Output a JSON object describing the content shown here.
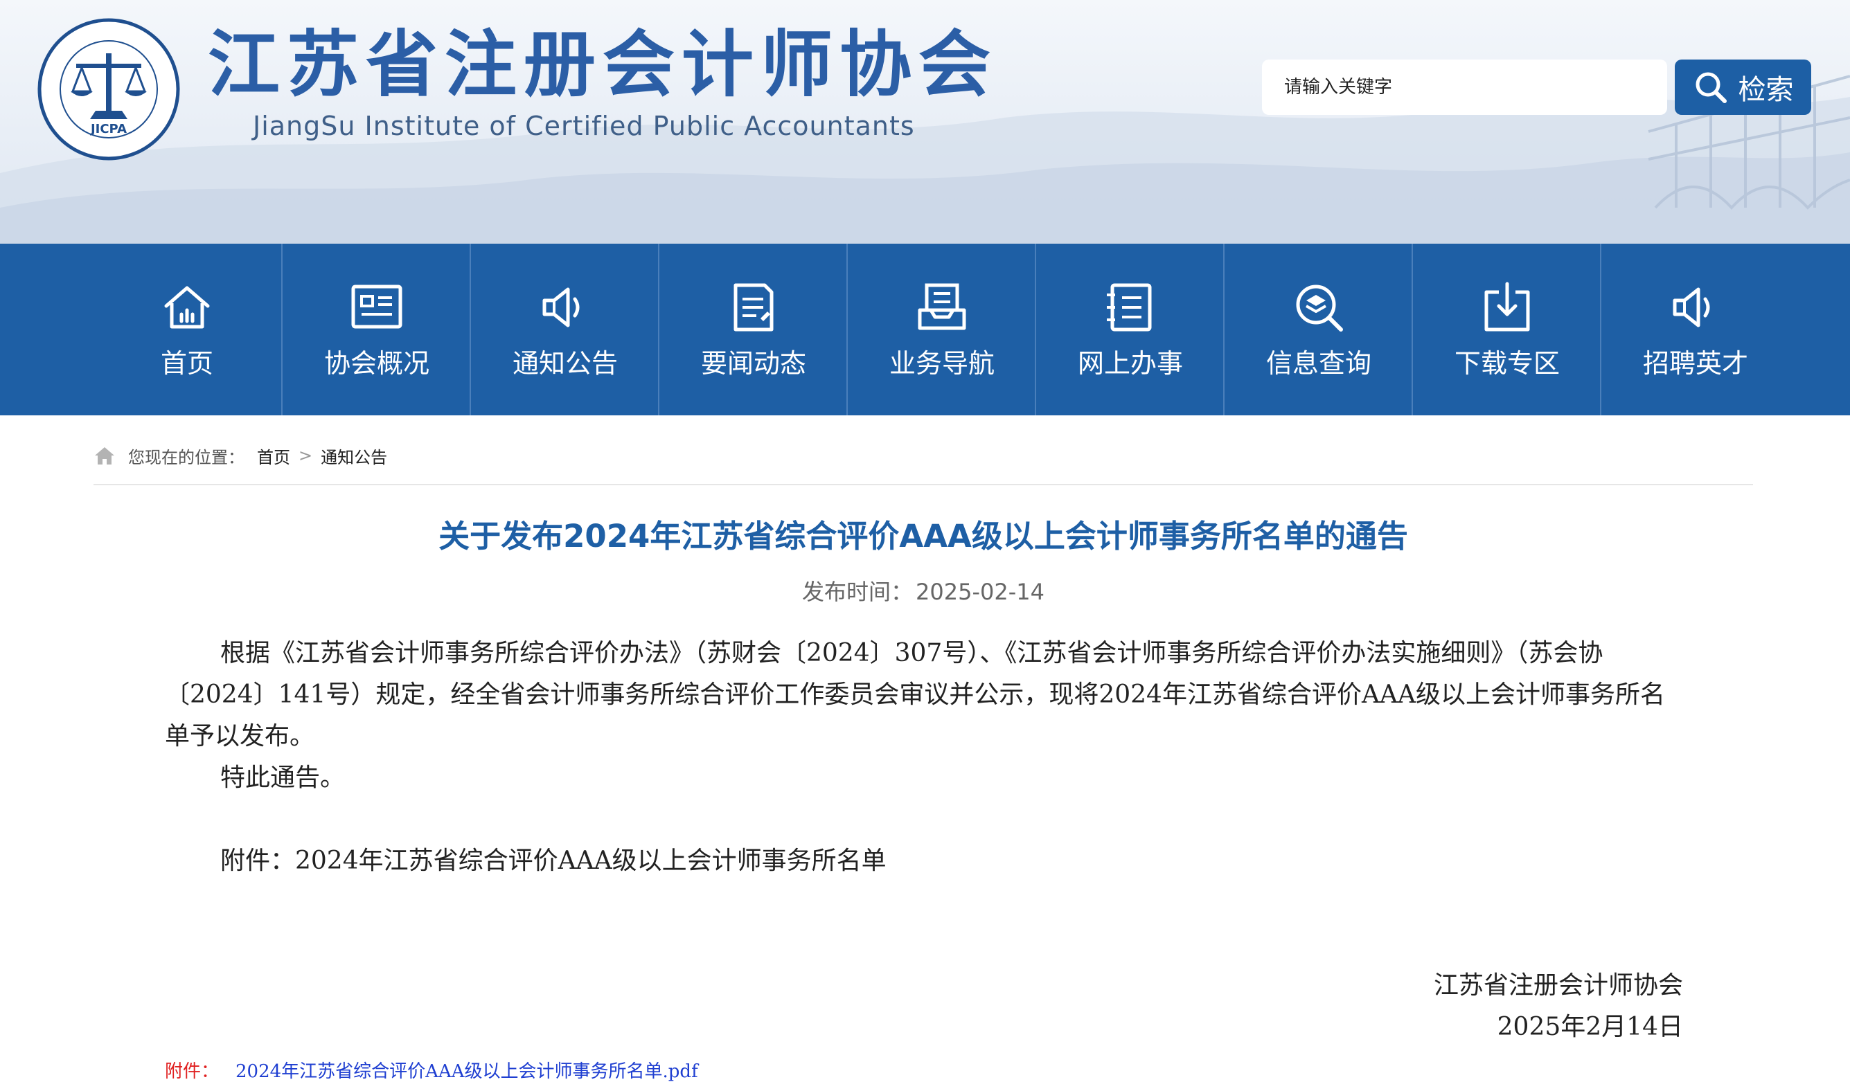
{
  "header": {
    "title": "江苏省注册会计师协会",
    "subtitle": "JiangSu Institute of Certified Public Accountants",
    "logo_text": "JIANGSU INSTITUTE OF CERTIFIED PUBLIC ACCOUNTANTS JICPA 江苏省注册会计师协会",
    "search_placeholder": "请输入关键字",
    "search_button": "检索"
  },
  "nav": {
    "items": [
      {
        "label": "首页",
        "icon": "home-icon"
      },
      {
        "label": "协会概况",
        "icon": "info-board-icon"
      },
      {
        "label": "通知公告",
        "icon": "speaker-icon"
      },
      {
        "label": "要闻动态",
        "icon": "document-icon"
      },
      {
        "label": "业务导航",
        "icon": "tray-icon"
      },
      {
        "label": "网上办事",
        "icon": "list-icon"
      },
      {
        "label": "信息查询",
        "icon": "search-layers-icon"
      },
      {
        "label": "下载专区",
        "icon": "download-icon"
      },
      {
        "label": "招聘英才",
        "icon": "speaker-icon"
      }
    ]
  },
  "breadcrumb": {
    "prefix": "您现在的位置：",
    "items": [
      "首页",
      "通知公告"
    ],
    "separator": ">"
  },
  "article": {
    "title": "关于发布2024年江苏省综合评价AAA级以上会计师事务所名单的通告",
    "date_label": "发布时间：",
    "date": "2025-02-14",
    "para1": "根据《江苏省会计师事务所综合评价办法》（苏财会〔2024〕307号）、《江苏省会计师事务所综合评价办法实施细则》（苏会协〔2024〕141号）规定，经全省会计师事务所综合评价工作委员会审议并公示，现将2024年江苏省综合评价AAA级以上会计师事务所名单予以发布。",
    "para2": "特此通告。",
    "para3": "附件：2024年江苏省综合评价AAA级以上会计师事务所名单",
    "signature_org": "江苏省注册会计师协会",
    "signature_date": "2025年2月14日",
    "attachment_label": "附件：",
    "attachment_link": "2024年江苏省综合评价AAA级以上会计师事务所名单.pdf"
  },
  "colors": {
    "brand_blue": "#1e5fa5",
    "title_blue": "#2b5ea6",
    "attachment_red": "#e02020",
    "link_blue": "#1f3fd1"
  }
}
